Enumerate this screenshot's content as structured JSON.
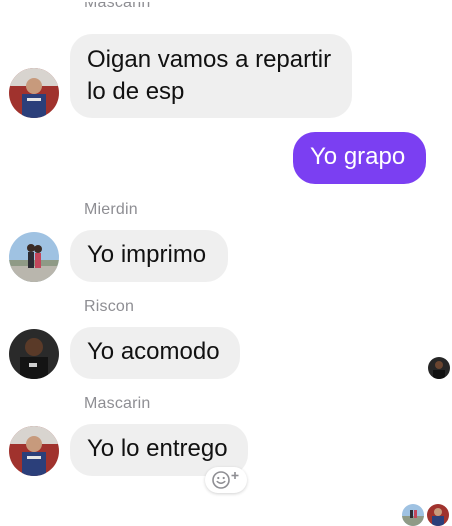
{
  "messages": [
    {
      "sender": "Mascarin",
      "text_line1": "Oigan vamos a repartir",
      "text_line2": "lo de esp"
    },
    {
      "text": "Yo grapo"
    },
    {
      "sender": "Mierdin",
      "text": "Yo imprimo"
    },
    {
      "sender": "Riscon",
      "text": "Yo acomodo"
    },
    {
      "sender": "Mascarin",
      "text": "Yo lo entrego"
    }
  ],
  "colors": {
    "outgoing_bubble": "#7b3ff2",
    "incoming_bubble": "#efefef",
    "sender_name": "#8e8e93"
  },
  "icons": {
    "reaction": "add-reaction-icon"
  }
}
